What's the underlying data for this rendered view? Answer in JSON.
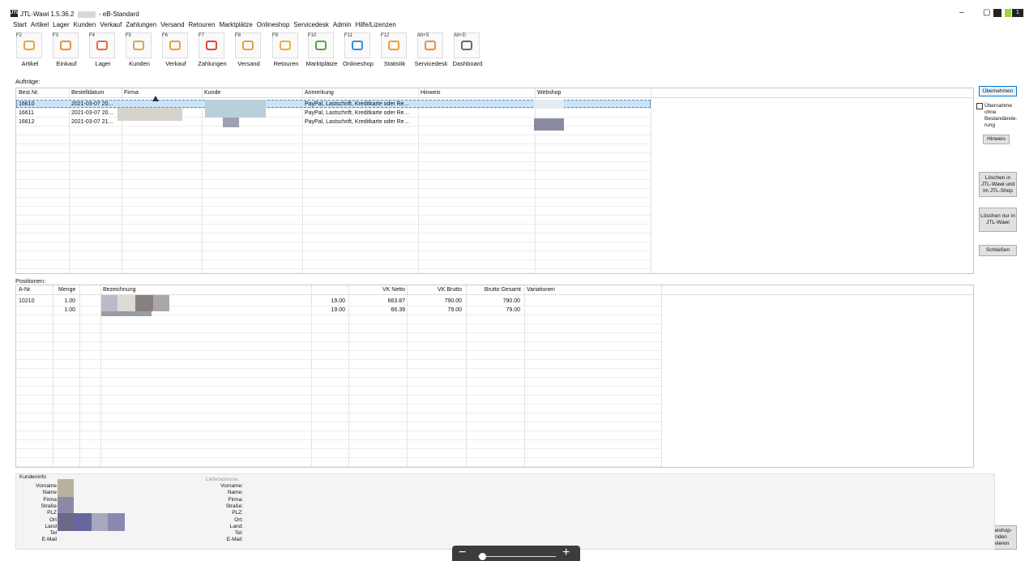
{
  "window": {
    "title_prefix": "JTL-Wawi 1.5.36.2",
    "title_suffix": "- eB-Standard",
    "app_icon_text": "JTL",
    "controls": [
      "–",
      "▢"
    ],
    "notification_count": "1"
  },
  "menu": [
    "Start",
    "Artikel",
    "Lager",
    "Kunden",
    "Verkauf",
    "Zahlungen",
    "Versand",
    "Retouren",
    "Marktplätze",
    "Onlineshop",
    "Servicedesk",
    "Admin",
    "Hilfe/Lizenzen"
  ],
  "toolbar": [
    {
      "key": "F2",
      "label": "Artikel",
      "icon": "article-icon"
    },
    {
      "key": "F3",
      "label": "Einkauf",
      "icon": "purchase-icon"
    },
    {
      "key": "F4",
      "label": "Lager",
      "icon": "warehouse-icon"
    },
    {
      "key": "F5",
      "label": "Kunden",
      "icon": "customers-icon"
    },
    {
      "key": "F6",
      "label": "Verkauf",
      "icon": "sales-icon"
    },
    {
      "key": "F7",
      "label": "Zahlungen",
      "icon": "payments-icon"
    },
    {
      "key": "F8",
      "label": "Versand",
      "icon": "shipping-icon"
    },
    {
      "key": "F9",
      "label": "Retouren",
      "icon": "returns-icon"
    },
    {
      "key": "F10",
      "label": "Marktplätze",
      "icon": "marketplaces-icon"
    },
    {
      "key": "F11",
      "label": "Onlineshop",
      "icon": "onlineshop-icon"
    },
    {
      "key": "F12",
      "label": "Statistik",
      "icon": "statistics-icon"
    },
    {
      "key": "Alt+S",
      "label": "Servicedesk",
      "icon": "servicedesk-icon"
    },
    {
      "key": "Alt+D",
      "label": "Dashboard",
      "icon": "dashboard-icon"
    }
  ],
  "orders": {
    "section_label": "Aufträge:",
    "columns": [
      "Best.Nr.",
      "Bestelldatum",
      "Firma",
      "Kunde",
      "Anmerkung",
      "Hinweis",
      "Webshop"
    ],
    "rows": [
      {
        "nr": "16610",
        "date": "2021-03-07 20...",
        "note": "PayPal, Lastschrift, Kreditkarte oder Re..."
      },
      {
        "nr": "16611",
        "date": "2021-03-07 20...",
        "note": "PayPal, Lastschrift, Kreditkarte oder Re..."
      },
      {
        "nr": "16612",
        "date": "2021-03-07 21...",
        "note": "PayPal, Lastschrift, Kreditkarte oder Re..."
      }
    ]
  },
  "positions": {
    "section_label": "Positionen:",
    "columns": [
      "A-Nr.",
      "Menge",
      "Bezeichnung",
      "VK Netto",
      "VK Brutto",
      "Brutto Gesamt",
      "Variationen"
    ],
    "rows": [
      {
        "anr": "10210",
        "menge": "1.00",
        "tax": "19.00",
        "netto": "663.87",
        "brutto": "790.00",
        "gesamt": "790.00"
      },
      {
        "anr": "",
        "menge": "1.00",
        "tax": "19.00",
        "netto": "66.39",
        "brutto": "79.00",
        "gesamt": "79.00"
      }
    ]
  },
  "side_buttons": {
    "apply": "Übernehmen",
    "apply_no_stock": "Übernahme ohne Bestandände-rung",
    "hint": "Hinweis",
    "delete_both": "Löschen in JTL-Wawi und im JTL-Shop",
    "delete_wawi": "Löschen nur in JTL-Wawi",
    "close": "Schließen",
    "activate_customers": "Onlineshop-Kunden aktivieren"
  },
  "customer_info": {
    "title": "Kundeninfo",
    "fields": [
      "Vorname",
      "Name",
      "Firma",
      "Straße",
      "PLZ",
      "Ort",
      "Land",
      "Tel",
      "E-Mail"
    ]
  },
  "delivery": {
    "title": "Lieferadresse:",
    "fields": [
      "Vorname:",
      "Name:",
      "Firma:",
      "Straße:",
      "PLZ:",
      "Ort:",
      "Land:",
      "Tel:",
      "E-Mail:"
    ]
  },
  "zoom": {
    "minus": "−",
    "plus": "+",
    "level": 0.05
  },
  "colors": {
    "selection": "#cce4f7",
    "primary_border": "#0078d7"
  }
}
